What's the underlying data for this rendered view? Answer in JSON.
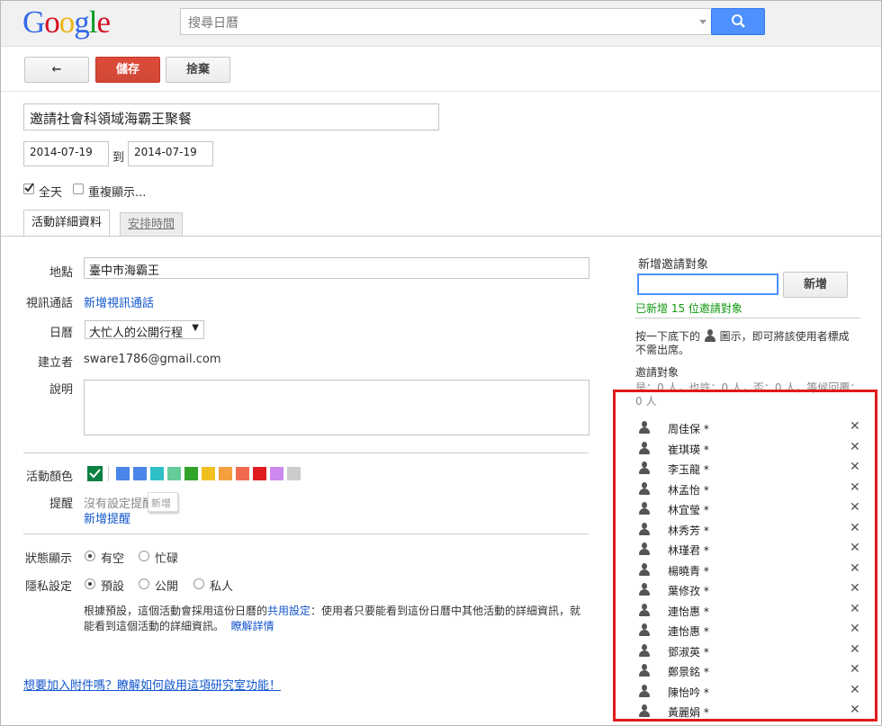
{
  "logo": {
    "letters": [
      "G",
      "o",
      "o",
      "g",
      "l",
      "e"
    ],
    "colors": [
      "#3369e8",
      "#d50f25",
      "#eeb211",
      "#3369e8",
      "#009925",
      "#d50f25"
    ]
  },
  "search": {
    "placeholder": "搜尋日曆"
  },
  "toolbar": {
    "back_label": "←",
    "save_label": "儲存",
    "discard_label": "捨棄"
  },
  "event": {
    "title": "邀請社會科領域海霸王聚餐",
    "start_date": "2014-07-19",
    "to_label": "到",
    "end_date": "2014-07-19",
    "allday_label": "全天",
    "allday_checked": true,
    "repeat_label": "重複顯示..."
  },
  "tabs": [
    {
      "label": "活動詳細資料",
      "active": true
    },
    {
      "label": "安排時間",
      "active": false
    }
  ],
  "details": {
    "where_label": "地點",
    "where_value": "臺中市海霸王",
    "video_label": "視訊通話",
    "video_link": "新增視訊通話",
    "calendar_label": "日曆",
    "calendar_value": "大忙人的公開行程",
    "creator_label": "建立者",
    "creator_value": "sware1786@gmail.com",
    "desc_label": "說明",
    "color_label": "活動顏色",
    "colors": [
      "#0b8043",
      "#4986e7",
      "#4a86e8",
      "#2fc0c6",
      "#66cc99",
      "#31a32a",
      "#f0c020",
      "#f4a040",
      "#f06a50",
      "#e11d21",
      "#cc88ee",
      "#cccccc"
    ],
    "reminder_label": "提醒",
    "reminder_none": "沒有設定提醒",
    "reminder_add": "新增提醒",
    "reminder_tip": "新增",
    "show_as_label": "狀態顯示",
    "show_as_options": [
      "有空",
      "忙碌"
    ],
    "privacy_label": "隱私設定",
    "privacy_options": [
      "預設",
      "公開",
      "私人"
    ],
    "privacy_note_1": "根據預設，這個活動會採用這份日曆的",
    "privacy_note_link": "共用設定",
    "privacy_note_2": "：使用者只要能看到這份日曆中其他活動的詳細資訊，就",
    "privacy_note_3": "能看到這個活動的詳細資訊。",
    "privacy_learn": "瞭解詳情",
    "attach_link": "想要加入附件嗎？瞭解如何啟用這項研究室功能！"
  },
  "guests_panel": {
    "add_title": "新增邀請對象",
    "add_button": "新增",
    "added_msg": "已新增 15 位邀請對象",
    "hint_1": "按一下底下的",
    "hint_2": "圖示，即可將該使用者標成",
    "hint_3": "不需出席。",
    "list_title": "邀請對象",
    "rsvp_line": "是：0 人，也許：0 人，否：0 人，等候回覆：",
    "rsvp_line2": "0 人",
    "guests": [
      "周佳保 *",
      "崔琪瑛 *",
      "李玉龍 *",
      "林孟怡 *",
      "林宜瑩 *",
      "林秀芳 *",
      "林瑾君 *",
      "楊曉青 *",
      "葉修孜 *",
      "連怡惠 *",
      "連怡惠 *",
      "鄧淑英 *",
      "鄭景銘 *",
      "陳怡吟 *",
      "黃麗娟 *"
    ]
  }
}
